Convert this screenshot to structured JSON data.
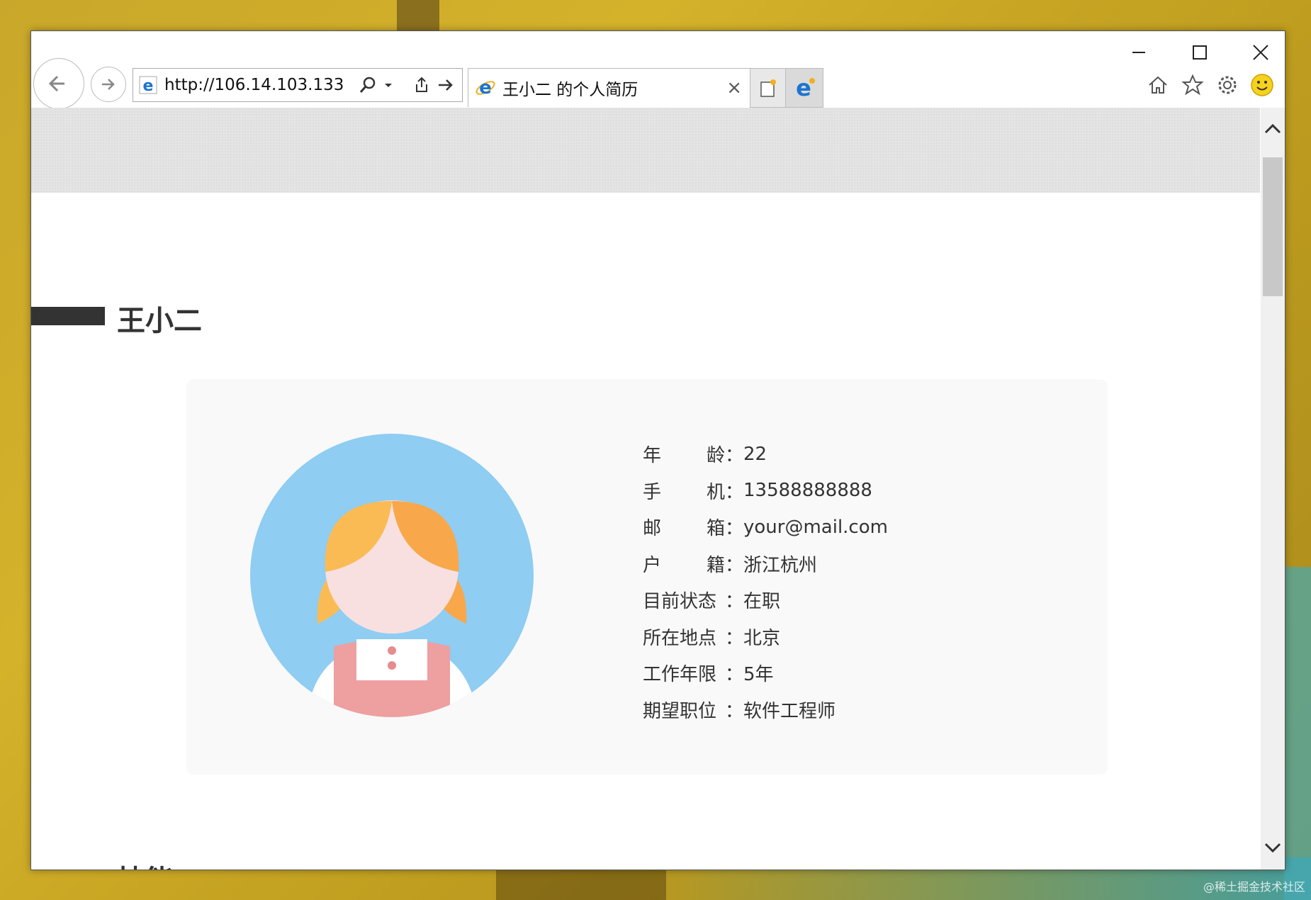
{
  "browser": {
    "address_url": "http://106.14.103.133",
    "tab_title": "王小二 的个人简历",
    "tab_close": "×"
  },
  "resume": {
    "name": "王小二",
    "next_section_title": "技能",
    "info": [
      {
        "label_chars": [
          "年",
          "龄"
        ],
        "value": "22"
      },
      {
        "label_chars": [
          "手",
          "机"
        ],
        "value": "13588888888"
      },
      {
        "label_chars": [
          "邮",
          "箱"
        ],
        "value": "your@mail.com"
      },
      {
        "label_chars": [
          "户",
          "籍"
        ],
        "value": "浙江杭州"
      },
      {
        "label_chars": [
          "目前状态"
        ],
        "value": "在职"
      },
      {
        "label_chars": [
          "所在地点"
        ],
        "value": "北京"
      },
      {
        "label_chars": [
          "工作年限"
        ],
        "value": "5年"
      },
      {
        "label_chars": [
          "期望职位"
        ],
        "value": "软件工程师"
      }
    ],
    "colon": "："
  },
  "watermark": "@稀土掘金技术社区",
  "colors": {
    "avatar_bg": "#8fcdf2",
    "hair": "#fbbb54",
    "hair_shadow": "#f8a84a",
    "face": "#f8e0e0",
    "dress": "#ee9fa0",
    "section_bar": "#333333"
  },
  "icons": [
    "back-arrow-icon",
    "forward-arrow-icon",
    "ie-icon",
    "search-icon",
    "dropdown-icon",
    "share-icon",
    "go-icon",
    "new-tab-icon",
    "edge-icon",
    "home-icon",
    "favorites-icon",
    "settings-icon",
    "smiley-icon",
    "minimize-icon",
    "maximize-icon",
    "close-icon"
  ]
}
